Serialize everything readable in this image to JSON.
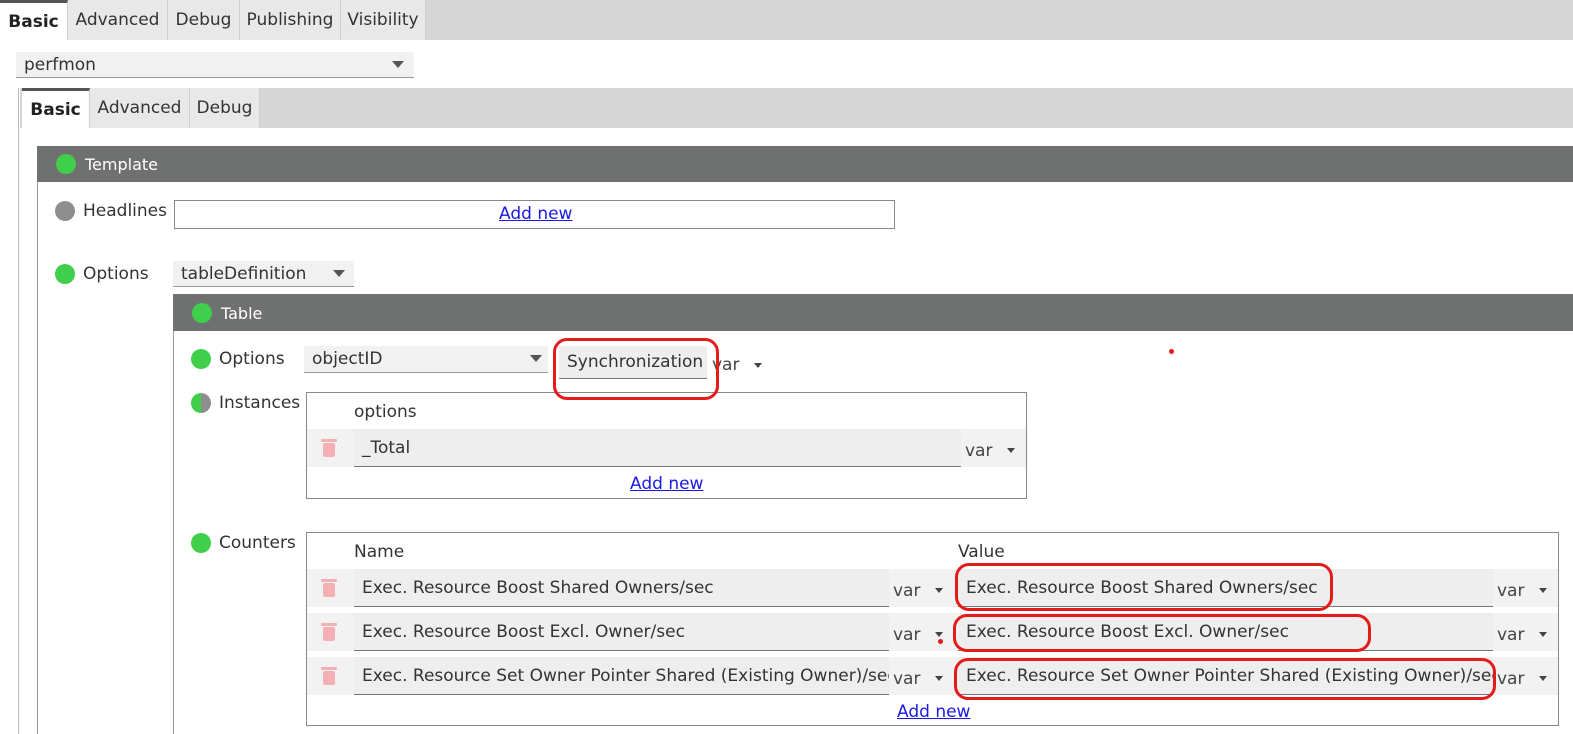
{
  "top_tabs": [
    "Basic",
    "Advanced",
    "Debug",
    "Publishing",
    "Visibility"
  ],
  "plugin_select": {
    "value": "perfmon"
  },
  "inner_tabs": [
    "Basic",
    "Advanced",
    "Debug"
  ],
  "template": {
    "header": "Template",
    "headlines_label": "Headlines",
    "headlines_add": "Add new",
    "options_label": "Options",
    "options_value": "tableDefinition"
  },
  "table": {
    "header": "Table",
    "options_label": "Options",
    "options_value": "objectID",
    "options_text": "Synchronization",
    "var": "var",
    "instances_label": "Instances",
    "instances_col": "options",
    "instances": [
      "_Total"
    ],
    "instances_add": "Add new",
    "counters_label": "Counters",
    "counters_cols": {
      "name": "Name",
      "value": "Value"
    },
    "counters": [
      {
        "name": "Exec. Resource Boost Shared Owners/sec",
        "value": "Exec. Resource Boost Shared Owners/sec"
      },
      {
        "name": "Exec. Resource Boost Excl. Owner/sec",
        "value": "Exec. Resource Boost Excl. Owner/sec"
      },
      {
        "name": "Exec. Resource Set Owner Pointer Shared (Existing Owner)/sec",
        "value": "Exec. Resource Set Owner Pointer Shared (Existing Owner)/sec"
      }
    ],
    "counters_add": "Add new"
  },
  "colors": {
    "accent_green": "#3fcf4a",
    "header_grey": "#6f7170",
    "annotation_red": "#e41b1b",
    "link_blue": "#1a1ae6"
  }
}
